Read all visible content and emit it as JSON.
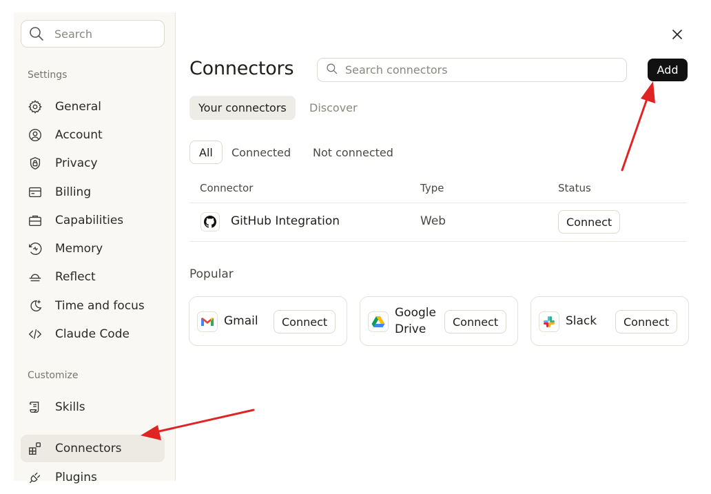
{
  "sidebar": {
    "search_placeholder": "Search",
    "settings_label": "Settings",
    "settings_items": [
      {
        "label": "General",
        "icon": "gear-icon"
      },
      {
        "label": "Account",
        "icon": "user-circle-icon"
      },
      {
        "label": "Privacy",
        "icon": "shield-lock-icon"
      },
      {
        "label": "Billing",
        "icon": "credit-card-icon"
      },
      {
        "label": "Capabilities",
        "icon": "briefcase-icon"
      },
      {
        "label": "Memory",
        "icon": "memory-icon"
      },
      {
        "label": "Reflect",
        "icon": "sunset-icon"
      },
      {
        "label": "Time and focus",
        "icon": "moon-plus-icon"
      },
      {
        "label": "Claude Code",
        "icon": "code-icon"
      }
    ],
    "customize_label": "Customize",
    "customize_items": [
      {
        "label": "Skills",
        "icon": "scroll-icon"
      },
      {
        "label": "Connectors",
        "icon": "connectors-icon",
        "active": true
      },
      {
        "label": "Plugins",
        "icon": "plug-icon"
      }
    ]
  },
  "main": {
    "title": "Connectors",
    "search_placeholder": "Search connectors",
    "add_label": "Add",
    "tabs": [
      {
        "label": "Your connectors",
        "active": true
      },
      {
        "label": "Discover",
        "active": false
      }
    ],
    "filters": [
      {
        "label": "All",
        "active": true
      },
      {
        "label": "Connected",
        "active": false
      },
      {
        "label": "Not connected",
        "active": false
      }
    ],
    "table": {
      "headers": [
        "Connector",
        "Type",
        "Status"
      ],
      "rows": [
        {
          "name": "GitHub Integration",
          "type": "Web",
          "action": "Connect",
          "icon": "github-icon"
        }
      ]
    },
    "popular_label": "Popular",
    "popular": [
      {
        "name": "Gmail",
        "action": "Connect",
        "icon": "gmail-icon"
      },
      {
        "name_line1": "Google",
        "name_line2": "Drive",
        "action": "Connect",
        "icon": "google-drive-icon"
      },
      {
        "name": "Slack",
        "action": "Connect",
        "icon": "slack-icon"
      }
    ]
  },
  "colors": {
    "accent_arrow": "#e02424",
    "add_button_bg": "#111111",
    "active_nav_bg": "#eceae3"
  }
}
